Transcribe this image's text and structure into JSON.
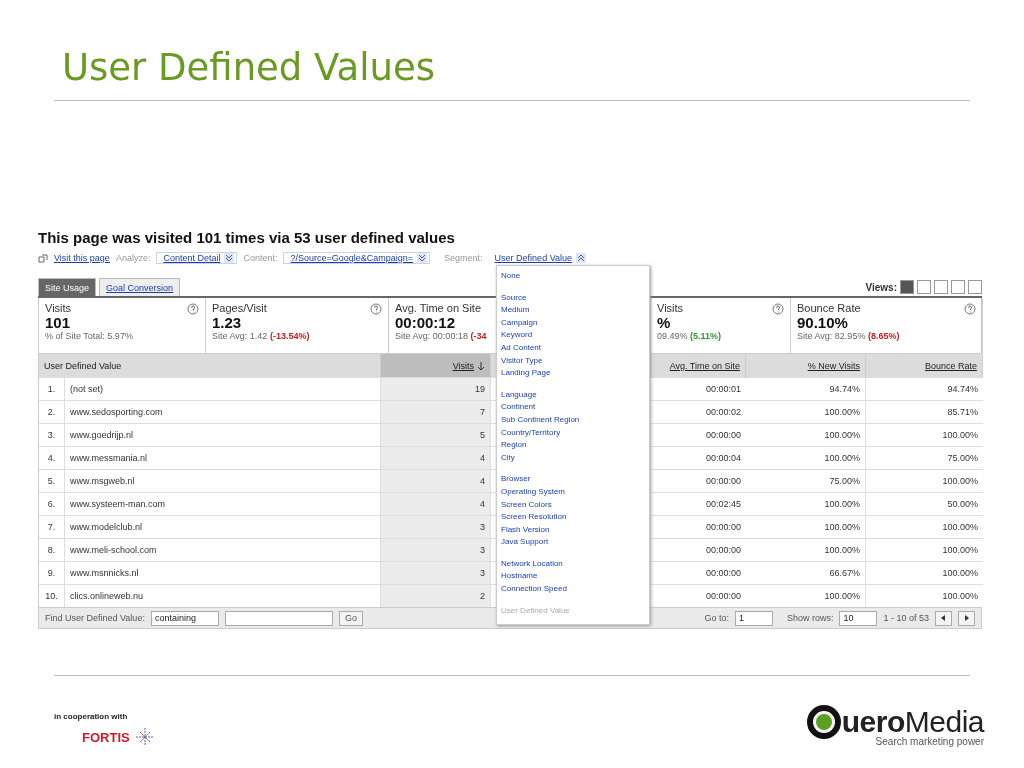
{
  "slide_title": "User Defined Values",
  "report": {
    "heading": "This page was visited 101 times via 53 user defined values",
    "toolbar": {
      "visit_link": "Visit this page",
      "analyze_label": "Analyze:",
      "analyze_value": "Content Detail",
      "content_label": "Content:",
      "content_value": "?/Source=Google&Campaign=",
      "segment_label": "Segment:",
      "segment_value": "User Defined Value"
    },
    "tabs": [
      {
        "label": "Site Usage",
        "selected": true
      },
      {
        "label": "Goal Conversion",
        "selected": false
      }
    ],
    "views": {
      "label": "Views:",
      "buttons": [
        {
          "selected": true
        },
        {
          "selected": false
        },
        {
          "selected": false
        },
        {
          "selected": false
        },
        {
          "selected": false
        }
      ]
    },
    "metrics": [
      {
        "label": "Visits",
        "value": "101",
        "sub": "% of Site Total: 5.97%",
        "help": true
      },
      {
        "label": "Pages/Visit",
        "value": "1.23",
        "sub": "Site Avg: 1.42",
        "change": {
          "text": "(-13.54%)",
          "positive": false
        },
        "help": true
      },
      {
        "label": "Avg. Time on Site",
        "value": "00:00:12",
        "sub": "Site Avg: 00:00:18",
        "change": {
          "text": "(-34",
          "positive": false
        }
      },
      {
        "label": "Visits",
        "value": "%",
        "sub": "09.49%",
        "change": {
          "text": "(5.11%)",
          "positive": true
        },
        "help": true
      },
      {
        "label": "Bounce Rate",
        "value": "90.10%",
        "sub": "Site Avg: 82.95%",
        "change": {
          "text": "(8.65%)",
          "positive": false
        },
        "help": true
      }
    ],
    "columns": [
      {
        "label": "User Defined Value",
        "sorted": false
      },
      {
        "label": "Visits",
        "sorted": true
      },
      {
        "label": "Avg. Time on Site",
        "sorted": false
      },
      {
        "label": "% New Visits",
        "sorted": false
      },
      {
        "label": "Bounce Rate",
        "sorted": false
      }
    ],
    "rows": [
      {
        "index": "1.",
        "value": "(not set)",
        "visits": "19",
        "avg_time": "00:00:01",
        "new_visits": "94.74%",
        "bounce_rate": "94.74%"
      },
      {
        "index": "2.",
        "value": "www.sedosporting.com",
        "visits": "7",
        "avg_time": "00:00:02",
        "new_visits": "100.00%",
        "bounce_rate": "85.71%"
      },
      {
        "index": "3.",
        "value": "www.goedrijp.nl",
        "visits": "5",
        "avg_time": "00:00:00",
        "new_visits": "100.00%",
        "bounce_rate": "100.00%"
      },
      {
        "index": "4.",
        "value": "www.messmania.nl",
        "visits": "4",
        "avg_time": "00:00:04",
        "new_visits": "100.00%",
        "bounce_rate": "75.00%"
      },
      {
        "index": "5.",
        "value": "www.msgweb.nl",
        "visits": "4",
        "avg_time": "00:00:00",
        "new_visits": "75.00%",
        "bounce_rate": "100.00%"
      },
      {
        "index": "6.",
        "value": "www.systeem-man.com",
        "visits": "4",
        "avg_time": "00:02:45",
        "new_visits": "100.00%",
        "bounce_rate": "50.00%"
      },
      {
        "index": "7.",
        "value": "www.modelclub.nl",
        "visits": "3",
        "avg_time": "00:00:00",
        "new_visits": "100.00%",
        "bounce_rate": "100.00%"
      },
      {
        "index": "8.",
        "value": "www.meli-school.com",
        "visits": "3",
        "avg_time": "00:00:00",
        "new_visits": "100.00%",
        "bounce_rate": "100.00%"
      },
      {
        "index": "9.",
        "value": "www.msnnicks.nl",
        "visits": "3",
        "avg_time": "00:00:00",
        "new_visits": "66.67%",
        "bounce_rate": "100.00%"
      },
      {
        "index": "10.",
        "value": "clics.onlineweb.nu",
        "visits": "2",
        "avg_time": "00:00:00",
        "new_visits": "100.00%",
        "bounce_rate": "100.00%"
      }
    ],
    "footer": {
      "find_label": "Find User Defined Value:",
      "match_select": "containing",
      "go_button": "Go",
      "goto_label": "Go to:",
      "goto_value": "1",
      "rows_label": "Show rows:",
      "rows_value": "10",
      "range": "1 - 10 of 53"
    },
    "segment_menu": {
      "groups": [
        {
          "items": [
            {
              "label": "None",
              "disabled": false
            }
          ]
        },
        {
          "items": [
            {
              "label": "Source",
              "disabled": false
            },
            {
              "label": "Medium",
              "disabled": false
            },
            {
              "label": "Campaign",
              "disabled": false
            },
            {
              "label": "Keyword",
              "disabled": false
            },
            {
              "label": "Ad Content",
              "disabled": false
            },
            {
              "label": "Visitor Type",
              "disabled": false
            },
            {
              "label": "Landing Page",
              "disabled": false
            }
          ]
        },
        {
          "items": [
            {
              "label": "Language",
              "disabled": false
            },
            {
              "label": "Continent",
              "disabled": false
            },
            {
              "label": "Sub Continent Region",
              "disabled": false
            },
            {
              "label": "Country/Territory",
              "disabled": false
            },
            {
              "label": "Region",
              "disabled": false
            },
            {
              "label": "City",
              "disabled": false
            }
          ]
        },
        {
          "items": [
            {
              "label": "Browser",
              "disabled": false
            },
            {
              "label": "Operating System",
              "disabled": false
            },
            {
              "label": "Screen Colors",
              "disabled": false
            },
            {
              "label": "Screen Resolution",
              "disabled": false
            },
            {
              "label": "Flash Version",
              "disabled": false
            },
            {
              "label": "Java Support",
              "disabled": false
            }
          ]
        },
        {
          "items": [
            {
              "label": "Network Location",
              "disabled": false
            },
            {
              "label": "Hostname",
              "disabled": false
            },
            {
              "label": "Connection Speed",
              "disabled": false
            }
          ]
        },
        {
          "items": [
            {
              "label": "User Defined Value",
              "disabled": true
            }
          ]
        }
      ]
    }
  },
  "partner": {
    "caption": "in cooperation with",
    "name": "FORTIS"
  },
  "logo": {
    "name": "**uero**Media",
    "tagline": "Search marketing power"
  }
}
